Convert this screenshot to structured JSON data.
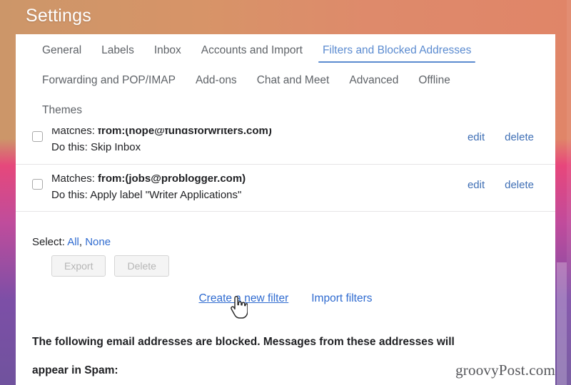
{
  "window": {
    "title": "Settings",
    "theme_gradient": {
      "top_left": "#cc9669",
      "top_right": "#e08568",
      "mid": "#e8417d",
      "bottom": "#6b4fa0"
    }
  },
  "tabs": {
    "row1": [
      {
        "label": "General",
        "active": false
      },
      {
        "label": "Labels",
        "active": false
      },
      {
        "label": "Inbox",
        "active": false
      },
      {
        "label": "Accounts and Import",
        "active": false
      },
      {
        "label": "Filters and Blocked Addresses",
        "active": true
      }
    ],
    "row2": [
      {
        "label": "Forwarding and POP/IMAP",
        "active": false
      },
      {
        "label": "Add-ons",
        "active": false
      },
      {
        "label": "Chat and Meet",
        "active": false
      },
      {
        "label": "Advanced",
        "active": false
      },
      {
        "label": "Offline",
        "active": false
      }
    ],
    "row3": [
      {
        "label": "Themes",
        "active": false
      }
    ],
    "active_tab": "Filters and Blocked Addresses",
    "active_color": "#5b8bd0"
  },
  "filters": {
    "rows": [
      {
        "matches_label": "Matches:",
        "matches_value": "from:(nope@fundsforwriters.com)",
        "action_label": "Do this:",
        "action_value": "Skip Inbox",
        "checked": false,
        "edit_label": "edit",
        "delete_label": "delete"
      },
      {
        "matches_label": "Matches:",
        "matches_value": "from:(jobs@problogger.com)",
        "action_label": "Do this:",
        "action_value": "Apply label \"Writer Applications\"",
        "checked": false,
        "edit_label": "edit",
        "delete_label": "delete"
      }
    ],
    "select": {
      "prefix": "Select:",
      "all_label": "All",
      "separator": ",",
      "none_label": "None"
    },
    "bulk_buttons": [
      {
        "label": "Export",
        "disabled": true
      },
      {
        "label": "Delete",
        "disabled": true
      }
    ],
    "links": [
      {
        "label": "Create a new filter",
        "hovered": true
      },
      {
        "label": "Import filters",
        "hovered": false
      }
    ]
  },
  "blocked": {
    "line1": "The following email addresses are blocked. Messages from these addresses will",
    "line2": "appear in Spam:"
  },
  "watermark": {
    "text": "groovyPost.com"
  },
  "cursor": {
    "type": "pointer-hand-cursor"
  }
}
